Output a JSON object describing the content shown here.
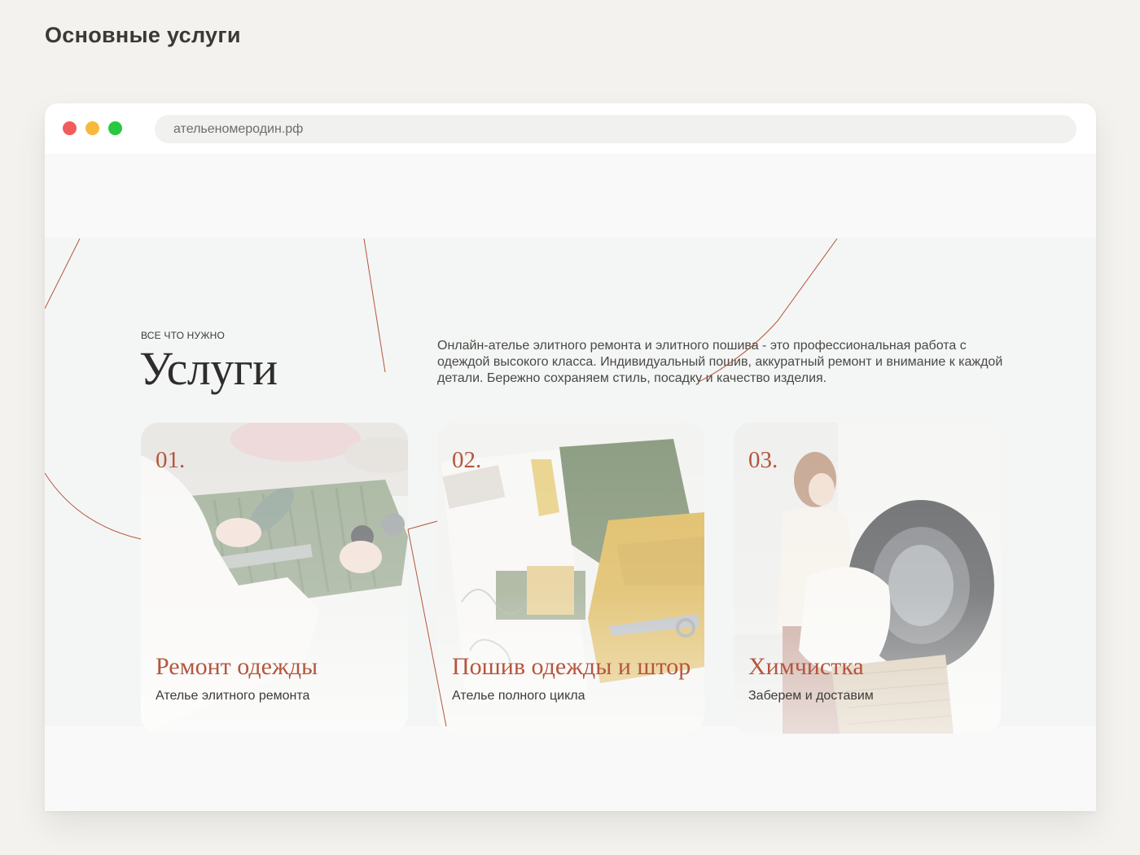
{
  "page": {
    "heading": "Основные услуги"
  },
  "browser": {
    "url": "ательеномеродин.рф",
    "window_controls": [
      "close",
      "minimize",
      "maximize"
    ]
  },
  "services": {
    "eyebrow": "ВСЕ ЧТО НУЖНО",
    "title": "Услуги",
    "intro": "Онлайн-ателье элитного ремонта и элитного пошива - это профессиональная работа с одеждой высокого класса. Индивидуальный пошив, аккуратный ремонт и внимание к каждой детали. Бережно сохраняем стиль, посадку и качество изделия.",
    "cards": [
      {
        "number": "01.",
        "title": "Ремонт одежды",
        "subtitle": "Ателье элитного ремонта"
      },
      {
        "number": "02.",
        "title": "Пошив одежды и штор",
        "subtitle": "Ателье полного цикла"
      },
      {
        "number": "03.",
        "title": "Химчистка",
        "subtitle": "Заберем и доставим"
      }
    ]
  },
  "colors": {
    "accent": "#b5563d",
    "page_background": "#f4f2ee",
    "section_background": "#f4f6f5",
    "dot_red": "#f15b5b",
    "dot_yellow": "#f6b93b",
    "dot_green": "#28c840"
  }
}
